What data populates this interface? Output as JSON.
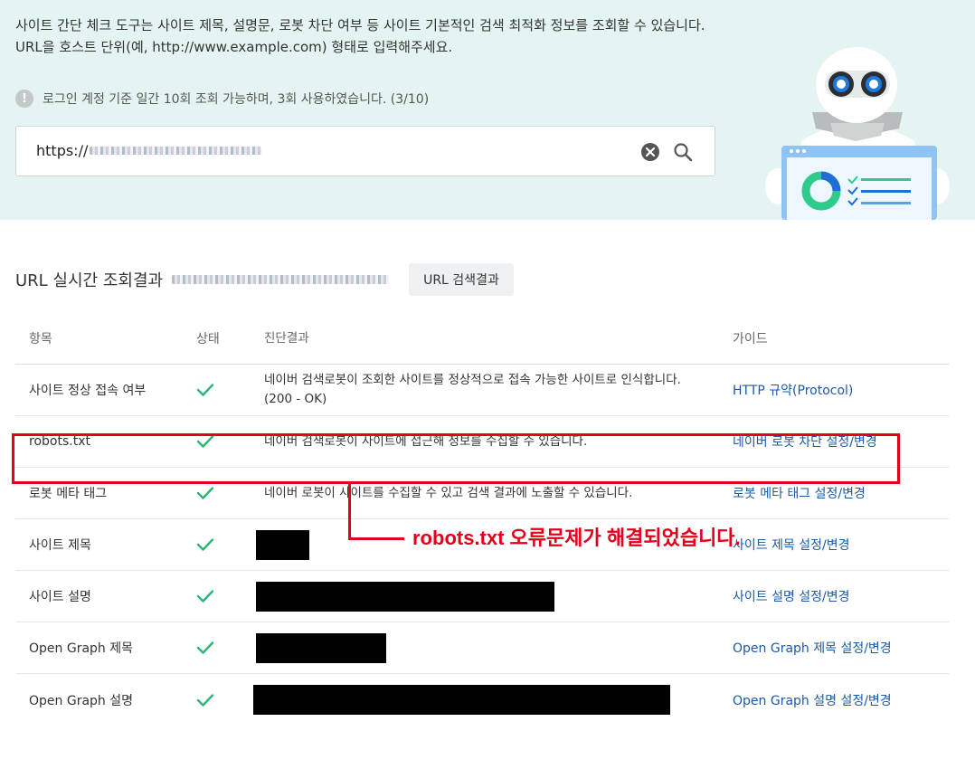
{
  "hero": {
    "description_line1": "사이트 간단 체크 도구는 사이트 제목, 설명문, 로봇 차단 여부 등 사이트 기본적인 검색 최적화 정보를 조회할 수 있습니다.",
    "description_line2": "URL을 호스트 단위(예, http://www.example.com) 형태로 입력해주세요.",
    "notice_icon": "!",
    "notice": "로그인 계정 기준 일간 10회 조회 가능하며, 3회 사용하였습니다. (3/10)",
    "search_value": "https://",
    "colors": {
      "background": "#e3f4f2",
      "accent": "#1a5aa6"
    }
  },
  "results": {
    "title": "URL 실시간 조회결과",
    "url_button": "URL 검색결과",
    "columns": [
      "항목",
      "상태",
      "진단결과",
      "가이드"
    ],
    "rows": [
      {
        "item": "사이트 정상 접속 여부",
        "status": "ok",
        "result_line1": "네이버 검색로봇이 조회한 사이트를 정상적으로 접속 가능한 사이트로 인식합니다.",
        "result_line2": "(200 - OK)",
        "guide": "HTTP 규약(Protocol)"
      },
      {
        "item": "robots.txt",
        "status": "ok",
        "result_line1": "네이버 검색로봇이 사이트에 접근해 정보를 수집할 수 있습니다.",
        "result_line2": "",
        "guide": "네이버 로봇 차단 설정/변경"
      },
      {
        "item": "로봇 메타 태그",
        "status": "ok",
        "result_line1": "네이버 로봇이 사이트를 수집할 수 있고 검색 결과에 노출할 수 있습니다.",
        "result_line2": "",
        "guide": "로봇 메타 태그 설정/변경"
      },
      {
        "item": "사이트 제목",
        "status": "ok",
        "result_line1": "",
        "result_line2": "",
        "guide": "사이트 제목 설정/변경"
      },
      {
        "item": "사이트 설명",
        "status": "ok",
        "result_line1": "",
        "result_line2": "",
        "guide": "사이트 설명 설정/변경"
      },
      {
        "item": "Open Graph 제목",
        "status": "ok",
        "result_line1": "",
        "result_line2": "",
        "guide": "Open Graph 제목 설정/변경"
      },
      {
        "item": "Open Graph 설명",
        "status": "ok",
        "result_line1": "",
        "result_line2": "",
        "guide": "Open Graph 설명 설정/변경"
      }
    ]
  },
  "annotation": {
    "text": "robots.txt 오류문제가 해결되었습니다.",
    "color": "#e3001b"
  },
  "icons": {
    "notice": "info-icon",
    "clear": "clear-icon",
    "search": "search-icon",
    "status": "check-icon",
    "mascot": "robot-mascot"
  }
}
